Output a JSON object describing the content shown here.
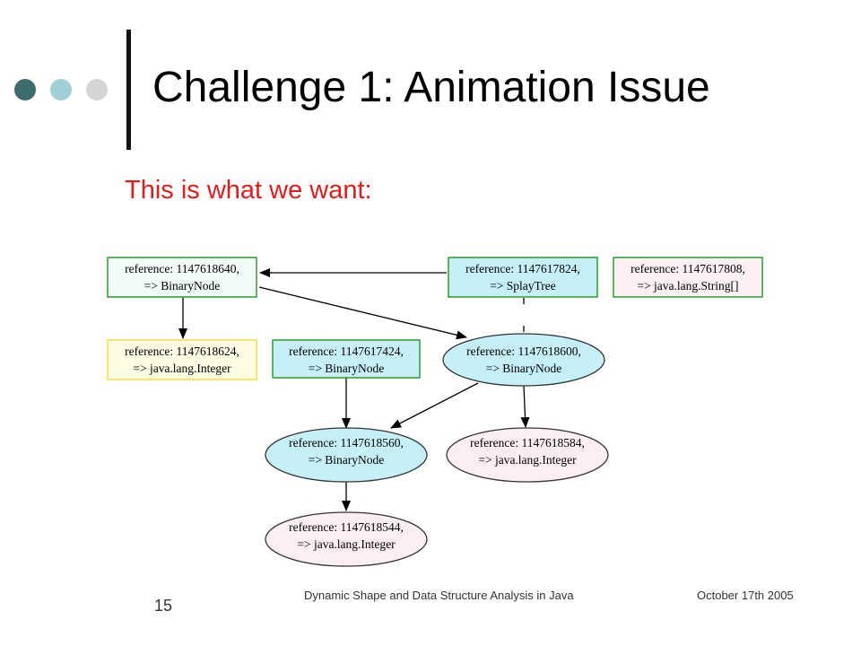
{
  "slide": {
    "title": "Challenge 1: Animation Issue",
    "subtitle": "This is what we want:",
    "page_number": "15",
    "footer_center": "Dynamic Shape and Data Structure Analysis in Java",
    "footer_right": "October 17th 2005"
  },
  "colors": {
    "subtitle": "#e21c1c",
    "dot_dark": "#3d6e6e",
    "dot_mid": "#9fd0d8",
    "dot_light": "#d4d4d4",
    "node_cyan": "#c6f0f8",
    "node_pink": "#fdeef3",
    "node_lightpink": "#fdf0f4",
    "node_yellow": "#fffce6",
    "border_green": "#2e9a2e",
    "border_yellow": "#f0e040",
    "border_dark": "#333333"
  },
  "diagram": {
    "nodes": [
      {
        "id": "n640",
        "line1": "reference: 1147618640,",
        "line2": "=> BinaryNode",
        "shape": "box",
        "fill": "#f2fbf9",
        "stroke": "#2e9a2e"
      },
      {
        "id": "n824",
        "line1": "reference: 1147617824,",
        "line2": "=> SplayTree",
        "shape": "box",
        "fill": "#c6f0f8",
        "stroke": "#2e9a2e"
      },
      {
        "id": "n808",
        "line1": "reference: 1147617808,",
        "line2": "=> java.lang.String[]",
        "shape": "box",
        "fill": "#fdf0f4",
        "stroke": "#2e9a2e"
      },
      {
        "id": "n624",
        "line1": "reference: 1147618624,",
        "line2": "=> java.lang.Integer",
        "shape": "box",
        "fill": "#fffce6",
        "stroke": "#f0e040"
      },
      {
        "id": "n424",
        "line1": "reference: 1147617424,",
        "line2": "=> BinaryNode",
        "shape": "box",
        "fill": "#c6f0f8",
        "stroke": "#2e9a2e"
      },
      {
        "id": "n600",
        "line1": "reference: 1147618600,",
        "line2": "=> BinaryNode",
        "shape": "ellipse",
        "fill": "#c6f0f8",
        "stroke": "#333333"
      },
      {
        "id": "n560",
        "line1": "reference: 1147618560,",
        "line2": "=> BinaryNode",
        "shape": "ellipse",
        "fill": "#c6f0f8",
        "stroke": "#333333"
      },
      {
        "id": "n584",
        "line1": "reference: 1147618584,",
        "line2": "=> java.lang.Integer",
        "shape": "ellipse",
        "fill": "#fdeef3",
        "stroke": "#333333"
      },
      {
        "id": "n544",
        "line1": "reference: 1147618544,",
        "line2": "=> java.lang.Integer",
        "shape": "ellipse",
        "fill": "#fdeef3",
        "stroke": "#333333"
      }
    ],
    "edges": [
      {
        "from": "n824",
        "to": "n640",
        "style": "solid"
      },
      {
        "from": "n640",
        "to": "n624",
        "style": "solid"
      },
      {
        "from": "n640",
        "to": "n600",
        "style": "solid"
      },
      {
        "from": "n824",
        "to": "n600",
        "style": "dashed"
      },
      {
        "from": "n424",
        "to": "n560",
        "style": "solid"
      },
      {
        "from": "n600",
        "to": "n560",
        "style": "solid"
      },
      {
        "from": "n600",
        "to": "n584",
        "style": "solid"
      },
      {
        "from": "n560",
        "to": "n544",
        "style": "solid"
      }
    ]
  }
}
